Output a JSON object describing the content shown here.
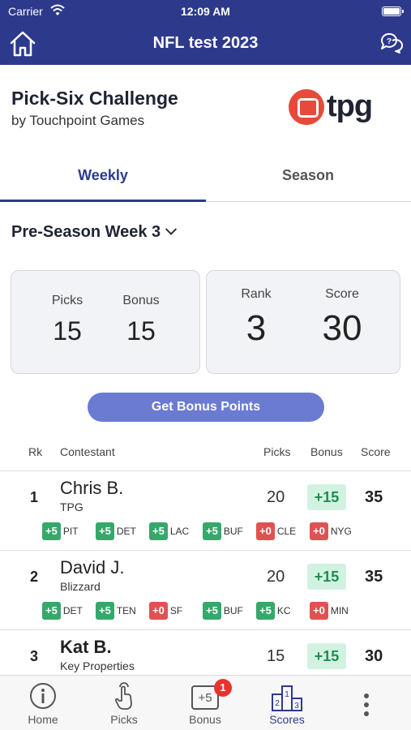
{
  "status_bar": {
    "carrier": "Carrier",
    "time": "12:09 AM"
  },
  "nav": {
    "title": "NFL test 2023"
  },
  "brand": {
    "title": "Pick-Six Challenge",
    "subtitle": "by Touchpoint Games",
    "logo_text": "tpg"
  },
  "tabs": [
    {
      "label": "Weekly",
      "active": true
    },
    {
      "label": "Season",
      "active": false
    }
  ],
  "week_selector": {
    "label": "Pre-Season Week 3"
  },
  "summary": {
    "picks_label": "Picks",
    "picks_value": "15",
    "bonus_label": "Bonus",
    "bonus_value": "15",
    "rank_label": "Rank",
    "rank_value": "3",
    "score_label": "Score",
    "score_value": "30"
  },
  "bonus_button": {
    "label": "Get Bonus Points"
  },
  "table": {
    "headers": {
      "rank": "Rk",
      "contestant": "Contestant",
      "picks": "Picks",
      "bonus": "Bonus",
      "score": "Score"
    },
    "rows": [
      {
        "rank": "1",
        "name": "Chris B.",
        "team": "TPG",
        "picks": "20",
        "bonus": "+15",
        "score": "35",
        "chips": [
          {
            "pts": "+5",
            "team": "PIT"
          },
          {
            "pts": "+5",
            "team": "DET"
          },
          {
            "pts": "+5",
            "team": "LAC"
          },
          {
            "pts": "+5",
            "team": "BUF"
          },
          {
            "pts": "+0",
            "team": "CLE"
          },
          {
            "pts": "+0",
            "team": "NYG"
          }
        ]
      },
      {
        "rank": "2",
        "name": "David J.",
        "team": "Blizzard",
        "picks": "20",
        "bonus": "+15",
        "score": "35",
        "chips": [
          {
            "pts": "+5",
            "team": "DET"
          },
          {
            "pts": "+5",
            "team": "TEN"
          },
          {
            "pts": "+0",
            "team": "SF"
          },
          {
            "pts": "+5",
            "team": "BUF"
          },
          {
            "pts": "+5",
            "team": "KC"
          },
          {
            "pts": "+0",
            "team": "MIN"
          }
        ]
      },
      {
        "rank": "3",
        "name": "Kat B.",
        "team": "Key Properties",
        "picks": "15",
        "bonus": "+15",
        "score": "30",
        "chips": []
      }
    ]
  },
  "tab_bar": {
    "items": [
      {
        "label": "Home",
        "icon": "info-icon"
      },
      {
        "label": "Picks",
        "icon": "tap-hand-icon"
      },
      {
        "label": "Bonus",
        "icon": "plus-five-icon",
        "icon_text": "+5",
        "badge": "1"
      },
      {
        "label": "Scores",
        "icon": "podium-icon",
        "active": true
      },
      {
        "label": "",
        "icon": "more-dots-icon"
      }
    ]
  },
  "colors": {
    "primary": "#2d3a8c",
    "button": "#6a7bd1",
    "positive": "#36a86a",
    "negative": "#e05252",
    "bonus_bg": "#d2f2e1"
  }
}
